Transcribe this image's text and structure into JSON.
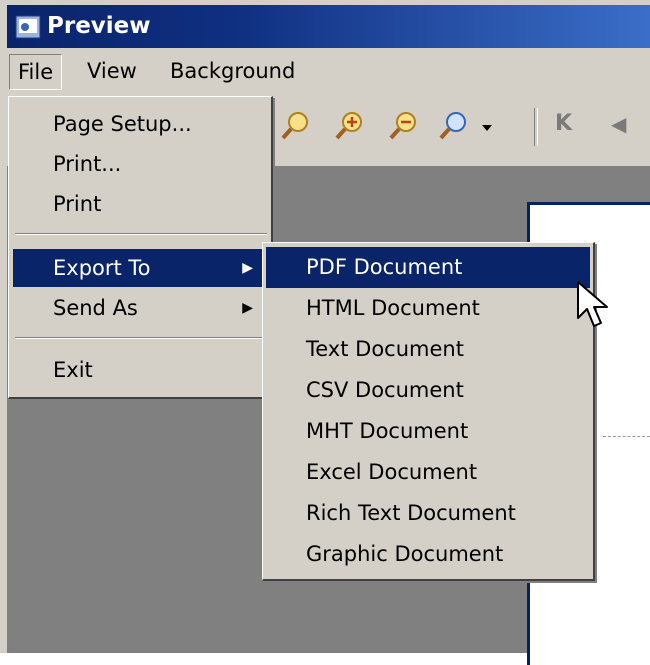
{
  "window": {
    "title": "Preview"
  },
  "menubar": {
    "items": [
      "File",
      "View",
      "Background"
    ]
  },
  "toolbar": {
    "first_page_glyph": "K",
    "prev_glyph": "◀"
  },
  "file_menu": {
    "items": [
      {
        "label": "Page Setup..."
      },
      {
        "label": "Print..."
      },
      {
        "label": "Print"
      },
      {
        "label": "Export To",
        "submenu": true,
        "highlighted": true
      },
      {
        "label": "Send As",
        "submenu": true
      },
      {
        "label": "Exit"
      }
    ]
  },
  "export_menu": {
    "items": [
      {
        "label": "PDF Document",
        "highlighted": true
      },
      {
        "label": "HTML Document"
      },
      {
        "label": "Text Document"
      },
      {
        "label": "CSV Document"
      },
      {
        "label": "MHT Document"
      },
      {
        "label": "Excel Document"
      },
      {
        "label": "Rich Text Document"
      },
      {
        "label": "Graphic Document"
      }
    ]
  },
  "colors": {
    "highlight": "#0a246a",
    "titlebar_start": "#0a246a",
    "titlebar_end": "#3b6ec8",
    "face": "#d4d0c8"
  },
  "icons": [
    "app-icon",
    "magnifier-icon",
    "zoom-in-icon",
    "zoom-out-icon",
    "zoom-dropdown-icon",
    "first-page-icon",
    "prev-page-icon",
    "submenu-arrow-icon",
    "mouse-cursor-icon"
  ]
}
